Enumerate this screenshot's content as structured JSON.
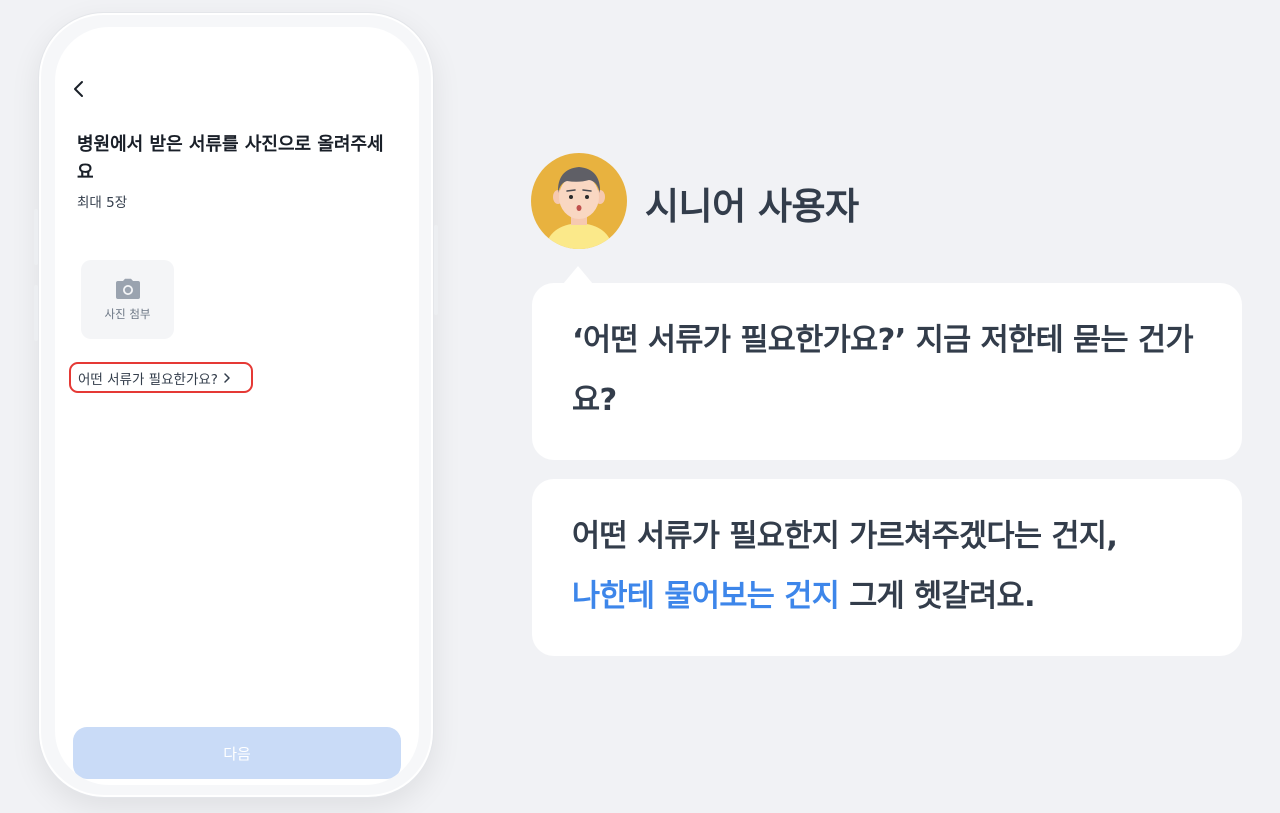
{
  "phone": {
    "title": "병원에서 받은 서류를 사진으로 올려주세요",
    "subtitle": "최대 5장",
    "attach_label": "사진 첨부",
    "doc_link_text": "어떤 서류가 필요한가요?",
    "next_label": "다음",
    "icons": {
      "back": "chevron-left-icon",
      "camera": "camera-icon",
      "doc_link": "chevron-right-icon"
    }
  },
  "persona": {
    "label": "시니어 사용자",
    "avatar_icon": "senior-user-avatar"
  },
  "bubbles": {
    "first": "‘어떤 서류가 필요한가요?’ 지금 저한테 묻는 건가요?",
    "second_plain": "어떤 서류가 필요한지 가르쳐주겠다는 건지,",
    "second_highlight": "나한테 물어보는 건지",
    "second_tail": " 그게 헷갈려요."
  },
  "colors": {
    "highlight": "#3d86ea",
    "annotation_border": "#e53935",
    "next_button": "#c9dbf7",
    "avatar_bg": "#e8b23f"
  }
}
